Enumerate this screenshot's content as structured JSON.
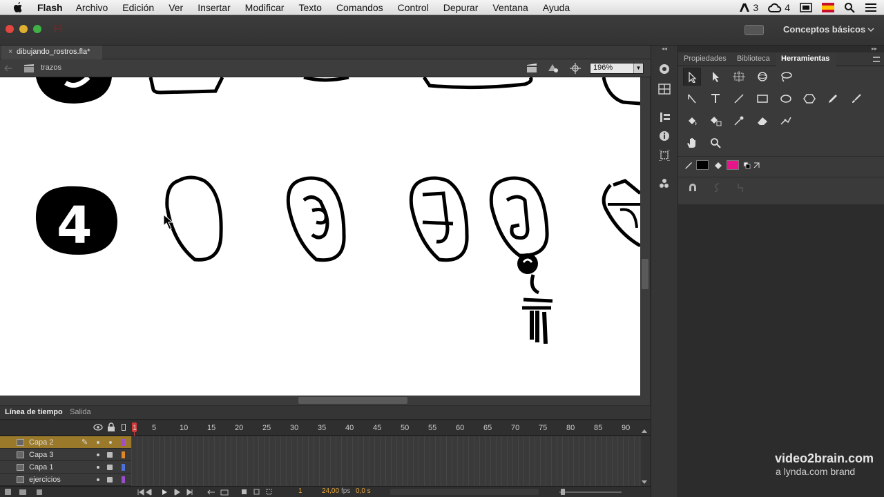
{
  "menubar": {
    "app": "Flash",
    "items": [
      "Archivo",
      "Edición",
      "Ver",
      "Insertar",
      "Modificar",
      "Texto",
      "Comandos",
      "Control",
      "Depurar",
      "Ventana",
      "Ayuda"
    ],
    "adobe_count": "3",
    "cc_count": "4"
  },
  "titlebar": {
    "logo": "Fl",
    "workspace": "Conceptos básicos"
  },
  "document": {
    "tab": "dibujando_rostros.fla*",
    "scene": "trazos",
    "zoom": "196%"
  },
  "stage": {
    "badge_digit": "4"
  },
  "timeline": {
    "tabs": [
      "Línea de tiempo",
      "Salida"
    ],
    "ruler": [
      "1",
      "5",
      "10",
      "15",
      "20",
      "25",
      "30",
      "35",
      "40",
      "45",
      "50",
      "55",
      "60",
      "65",
      "70",
      "75",
      "80",
      "85",
      "90"
    ],
    "layers": [
      {
        "name": "Capa 2",
        "color": "#a24dc4",
        "selected": true
      },
      {
        "name": "Capa 3",
        "color": "#e0872a",
        "selected": false
      },
      {
        "name": "Capa 1",
        "color": "#4a72d8",
        "selected": false
      },
      {
        "name": "ejercicios",
        "color": "#9b4ec9",
        "selected": false
      }
    ],
    "current_frame": "1",
    "fps": "24,00",
    "fps_label": "fps",
    "time": "0,0 s"
  },
  "right_panel": {
    "tabs": [
      "Propiedades",
      "Biblioteca",
      "Herramientas"
    ],
    "active_tab": "Herramientas",
    "stroke_color": "#000000",
    "fill_color": "#e6168a"
  },
  "watermark": {
    "line1": "video2brain.com",
    "line2": "a lynda.com brand"
  }
}
